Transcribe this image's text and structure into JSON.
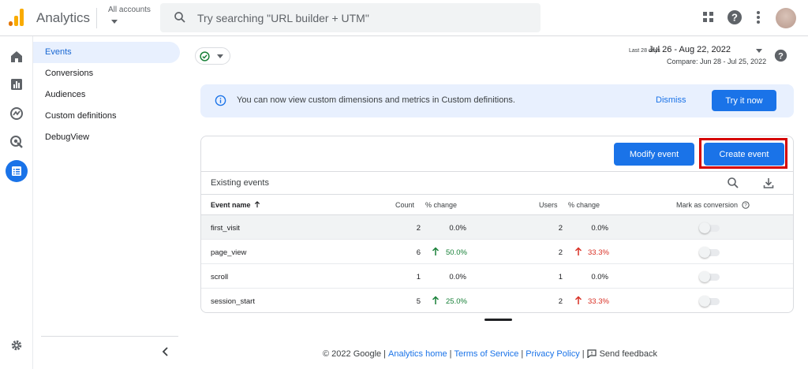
{
  "header": {
    "brand": "Analytics",
    "account_label": "All accounts",
    "search_placeholder": "Try searching \"URL builder + UTM\""
  },
  "subnav": {
    "items": [
      {
        "label": "Events",
        "active": true
      },
      {
        "label": "Conversions",
        "active": false
      },
      {
        "label": "Audiences",
        "active": false
      },
      {
        "label": "Custom definitions",
        "active": false
      },
      {
        "label": "DebugView",
        "active": false
      }
    ]
  },
  "date": {
    "period_label": "Last 28 days",
    "range": "Jul 26 - Aug 22, 2022",
    "compare": "Compare: Jun 28 - Jul 25, 2022"
  },
  "banner": {
    "text": "You can now view custom dimensions and metrics in Custom definitions.",
    "dismiss_label": "Dismiss",
    "try_label": "Try it now"
  },
  "card": {
    "modify_label": "Modify event",
    "create_label": "Create event",
    "section_title": "Existing events",
    "columns": {
      "event_name": "Event name",
      "count": "Count",
      "count_change": "% change",
      "users": "Users",
      "users_change": "% change",
      "mark_conversion": "Mark as conversion"
    },
    "rows": [
      {
        "name": "first_visit",
        "count": "2",
        "count_change": "0.0%",
        "count_trend": "none",
        "users": "2",
        "users_change": "0.0%",
        "users_trend": "none"
      },
      {
        "name": "page_view",
        "count": "6",
        "count_change": "50.0%",
        "count_trend": "up",
        "users": "2",
        "users_change": "33.3%",
        "users_trend": "up-red"
      },
      {
        "name": "scroll",
        "count": "1",
        "count_change": "0.0%",
        "count_trend": "none",
        "users": "1",
        "users_change": "0.0%",
        "users_trend": "none"
      },
      {
        "name": "session_start",
        "count": "5",
        "count_change": "25.0%",
        "count_trend": "up",
        "users": "2",
        "users_change": "33.3%",
        "users_trend": "up-red"
      }
    ]
  },
  "footer": {
    "copyright": "© 2022 Google",
    "links": [
      "Analytics home",
      "Terms of Service",
      "Privacy Policy"
    ],
    "feedback": "Send feedback"
  },
  "colors": {
    "accent": "#1a73e8",
    "positive": "#188038",
    "negative": "#d93025",
    "highlight": "#d50000"
  }
}
